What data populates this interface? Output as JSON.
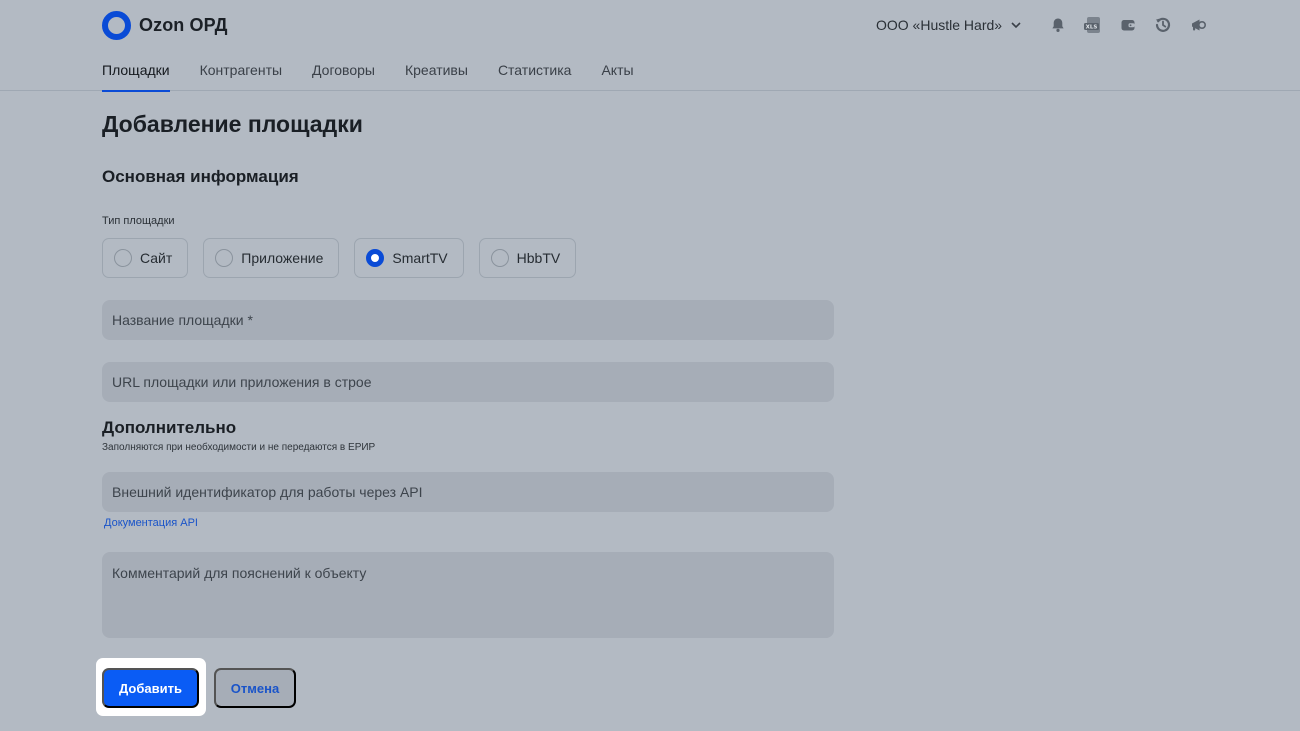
{
  "app": {
    "title": "Ozon ОРД",
    "org_name": "ООО «Hustle Hard»"
  },
  "toolbar_icons": [
    "bell-icon",
    "xls-export-icon",
    "wallet-icon",
    "history-icon",
    "megaphone-icon"
  ],
  "nav": {
    "tabs": [
      {
        "label": "Площадки",
        "active": true
      },
      {
        "label": "Контрагенты",
        "active": false
      },
      {
        "label": "Договоры",
        "active": false
      },
      {
        "label": "Креативы",
        "active": false
      },
      {
        "label": "Статистика",
        "active": false
      },
      {
        "label": "Акты",
        "active": false
      }
    ]
  },
  "page": {
    "title": "Добавление площадки"
  },
  "basic": {
    "section_title": "Основная информация",
    "type_label": "Тип площадки",
    "types": [
      {
        "label": "Сайт",
        "selected": false
      },
      {
        "label": "Приложение",
        "selected": false
      },
      {
        "label": "SmartTV",
        "selected": true
      },
      {
        "label": "HbbTV",
        "selected": false
      }
    ],
    "name_placeholder": "Название площадки *",
    "url_placeholder": "URL площадки или приложения в строе"
  },
  "extra": {
    "title": "Дополнительно",
    "subtitle": "Заполняются при необходимости и не передаются в ЕРИР",
    "external_id_placeholder": "Внешний идентификатор для работы через API",
    "api_doc_link": "Документация API",
    "comment_placeholder": "Комментарий для пояснений к объекту"
  },
  "actions": {
    "submit_label": "Добавить",
    "cancel_label": "Отмена"
  },
  "colors": {
    "accent": "#0a5cf5",
    "link": "#1a54c9",
    "background": "#b3bac3"
  }
}
